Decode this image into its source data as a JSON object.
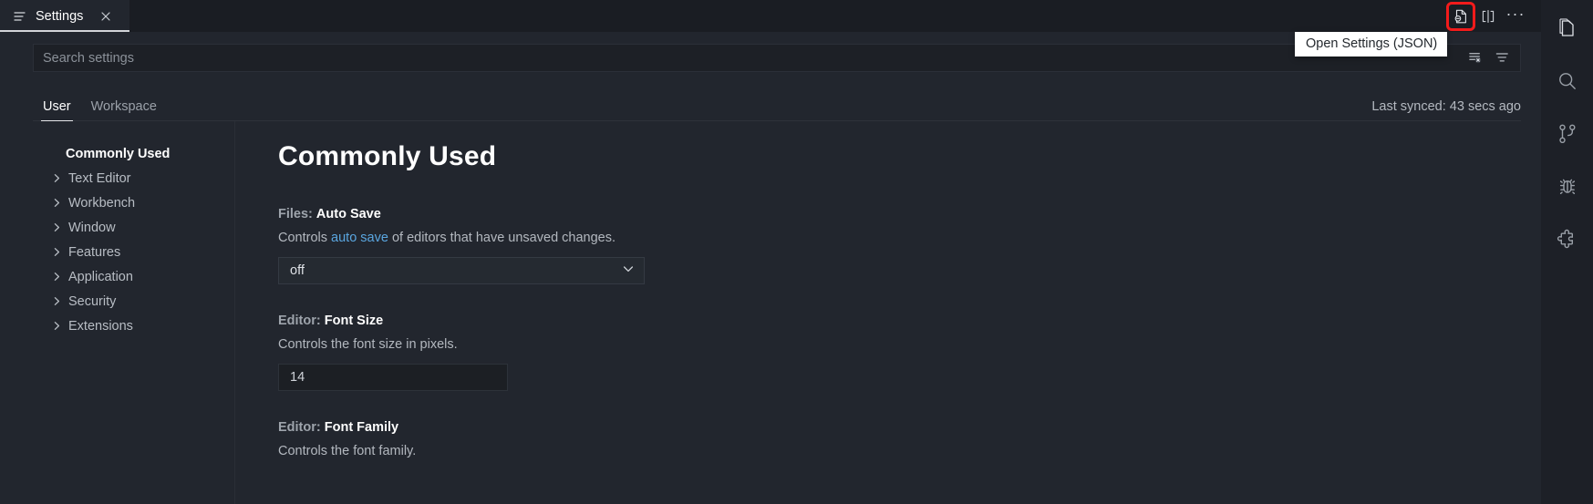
{
  "window": {
    "tab": {
      "label": "Settings",
      "icon": "settings-lines-icon",
      "close_icon": "close-icon"
    },
    "tab_actions": [
      {
        "name": "open-settings-json",
        "icon": "file-code-icon",
        "annotated": true
      },
      {
        "name": "split-editor",
        "icon": "split-editor-icon",
        "annotated": false
      },
      {
        "name": "more-actions",
        "icon": "ellipsis-icon",
        "annotated": false
      }
    ],
    "tooltip": "Open Settings (JSON)",
    "annotation_color": "#f31b1b"
  },
  "search": {
    "placeholder": "Search settings",
    "value": "",
    "actions": [
      {
        "name": "clear-search-results-icon",
        "title": "Clear Settings Search Results"
      },
      {
        "name": "filter-settings-icon",
        "title": "Filter Settings"
      }
    ]
  },
  "scopes": {
    "tabs": [
      {
        "label": "User",
        "active": true
      },
      {
        "label": "Workspace",
        "active": false
      }
    ],
    "sync_status": "Last synced: 43 secs ago"
  },
  "toc": {
    "items": [
      {
        "label": "Commonly Used",
        "active": true,
        "expandable": false
      },
      {
        "label": "Text Editor",
        "active": false,
        "expandable": true
      },
      {
        "label": "Workbench",
        "active": false,
        "expandable": true
      },
      {
        "label": "Window",
        "active": false,
        "expandable": true
      },
      {
        "label": "Features",
        "active": false,
        "expandable": true
      },
      {
        "label": "Application",
        "active": false,
        "expandable": true
      },
      {
        "label": "Security",
        "active": false,
        "expandable": true
      },
      {
        "label": "Extensions",
        "active": false,
        "expandable": true
      }
    ]
  },
  "main": {
    "title": "Commonly Used",
    "settings": [
      {
        "category": "Files:",
        "name": "Auto Save",
        "desc_before": "Controls ",
        "desc_link": "auto save",
        "desc_after": " of editors that have unsaved changes.",
        "control": "select",
        "value": "off"
      },
      {
        "category": "Editor:",
        "name": "Font Size",
        "desc_before": "Controls the font size in pixels.",
        "desc_link": "",
        "desc_after": "",
        "control": "text",
        "value": "14"
      },
      {
        "category": "Editor:",
        "name": "Font Family",
        "desc_before": "Controls the font family.",
        "desc_link": "",
        "desc_after": "",
        "control": "none",
        "value": ""
      }
    ]
  },
  "activitybar": {
    "items": [
      {
        "name": "explorer-files-icon",
        "label": "Explorer",
        "active": true
      },
      {
        "name": "search-icon",
        "label": "Search",
        "active": false
      },
      {
        "name": "source-control-branch-icon",
        "label": "Source Control",
        "active": false
      },
      {
        "name": "run-and-debug-bug-icon",
        "label": "Run and Debug",
        "active": false
      },
      {
        "name": "extensions-puzzle-icon",
        "label": "Extensions",
        "active": false
      }
    ]
  }
}
